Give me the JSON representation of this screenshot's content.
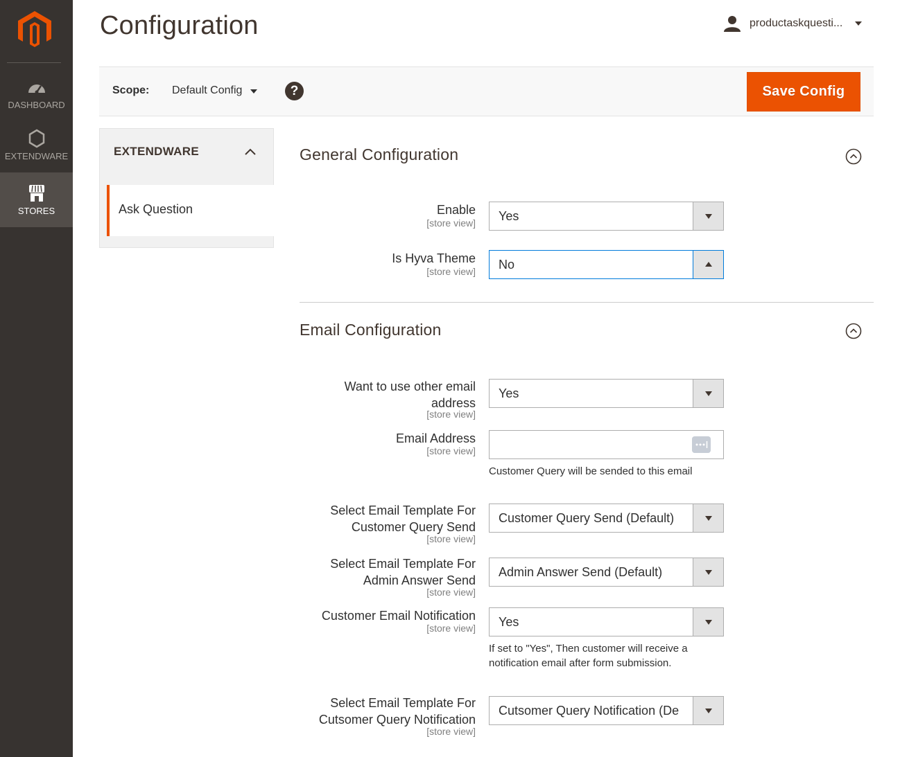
{
  "sidebar": {
    "items": [
      {
        "label": "DASHBOARD",
        "icon": "dashboard-icon"
      },
      {
        "label": "EXTENDWARE",
        "icon": "hexagon-icon"
      },
      {
        "label": "STORES",
        "icon": "store-icon",
        "active": true
      }
    ]
  },
  "header": {
    "title": "Configuration",
    "user": "productaskquesti..."
  },
  "scope": {
    "label": "Scope:",
    "value": "Default Config",
    "help": "?",
    "save_label": "Save Config"
  },
  "tabs": {
    "group": "EXTENDWARE",
    "items": [
      {
        "label": "Ask Question",
        "active": true
      }
    ]
  },
  "general": {
    "title": "General Configuration",
    "fields": [
      {
        "label": "Enable",
        "scope": "[store view]",
        "value": "Yes"
      },
      {
        "label": "Is Hyva Theme",
        "scope": "[store view]",
        "value": "No"
      }
    ]
  },
  "email": {
    "title": "Email Configuration",
    "fields": [
      {
        "label_line1": "Want to use other email",
        "label_line2": "address",
        "scope": "[store view]",
        "value": "Yes"
      },
      {
        "label": "Email Address",
        "scope": "[store view]",
        "value": "",
        "note": "Customer Query will be sended to this email"
      },
      {
        "label_line1": "Select Email Template For",
        "label_line2": "Customer Query Send",
        "scope": "[store view]",
        "value": "Customer Query Send (Default)"
      },
      {
        "label_line1": "Select Email Template For",
        "label_line2": "Admin Answer Send",
        "scope": "[store view]",
        "value": "Admin Answer Send (Default)"
      },
      {
        "label": "Customer Email Notification",
        "scope": "[store view]",
        "value": "Yes",
        "note_line1": "If set to \"Yes\", Then customer will receive a",
        "note_line2": "notification email after form submission."
      },
      {
        "label_line1": "Select Email Template For",
        "label_line2": "Cutsomer Query Notification",
        "scope": "[store view]",
        "value": "Cutsomer Query Notification (De"
      }
    ]
  },
  "colors": {
    "accent": "#eb5202",
    "sidebar": "#373330",
    "focus": "#007bdb"
  }
}
